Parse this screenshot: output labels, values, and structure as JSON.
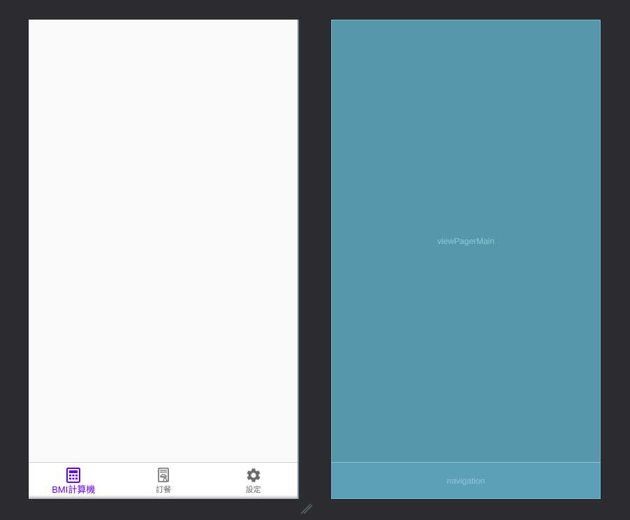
{
  "design_view": {
    "bottom_navigation": {
      "items": [
        {
          "label": "BMI計算機",
          "icon": "calculator-icon",
          "active": true
        },
        {
          "label": "訂餐",
          "icon": "food-order-icon",
          "active": false
        },
        {
          "label": "設定",
          "icon": "gear-icon",
          "active": false
        }
      ]
    }
  },
  "blueprint_view": {
    "viewpager_label": "viewPagerMain",
    "navigation_label": "navigation"
  },
  "colors": {
    "active": "#6200ee",
    "inactive": "#6b6b6b",
    "blueprint": "#5597ab",
    "canvas": "#2b2d30"
  }
}
